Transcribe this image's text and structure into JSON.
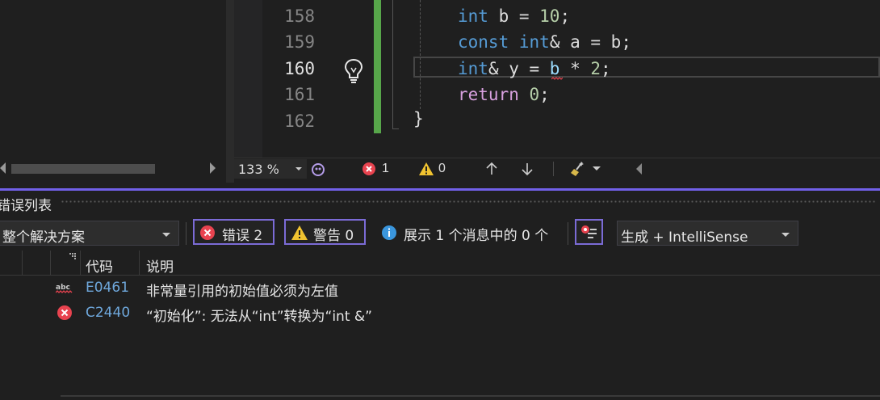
{
  "editor": {
    "lines": [
      {
        "number": "158",
        "current": false
      },
      {
        "number": "159",
        "current": false
      },
      {
        "number": "160",
        "current": true
      },
      {
        "number": "161",
        "current": false
      },
      {
        "number": "162",
        "current": false
      }
    ],
    "code": {
      "l158": {
        "kw": "int",
        "rest": " b = ",
        "num": "10",
        "end": ";"
      },
      "l159": {
        "kw": "const",
        "sp": " ",
        "kw2": "int",
        "rest": "& a = b;"
      },
      "l160": {
        "kw": "int",
        "rest": "& y = ",
        "var": "b",
        "rest2": " * ",
        "num": "2",
        "end": ";"
      },
      "l161": {
        "kw": "return",
        "rest": " ",
        "num": "0",
        "end": ";"
      },
      "l162": {
        "brace": "}"
      }
    },
    "status": {
      "zoom": "133 %",
      "error_count": "1",
      "warning_count": "0"
    }
  },
  "error_list": {
    "title": "错误列表",
    "scope": "整个解决方案",
    "errors_button": "错误 2",
    "warnings_button": "警告 0",
    "messages_text": "展示 1 个消息中的 0 个",
    "source_filter": "生成 + IntelliSense",
    "columns": {
      "code": "代码",
      "description": "说明"
    },
    "rows": [
      {
        "icon": "spelling-abc-icon",
        "code": "E0461",
        "description": "非常量引用的初始值必须为左值"
      },
      {
        "icon": "error-icon",
        "code": "C2440",
        "description": "“初始化”: 无法从“int”转换为“int &”"
      }
    ]
  },
  "colors": {
    "accent": "#7160e8",
    "error": "#e8434f",
    "warning": "#f0c330",
    "info": "#3a96dd",
    "change_bar": "#57a64a"
  }
}
